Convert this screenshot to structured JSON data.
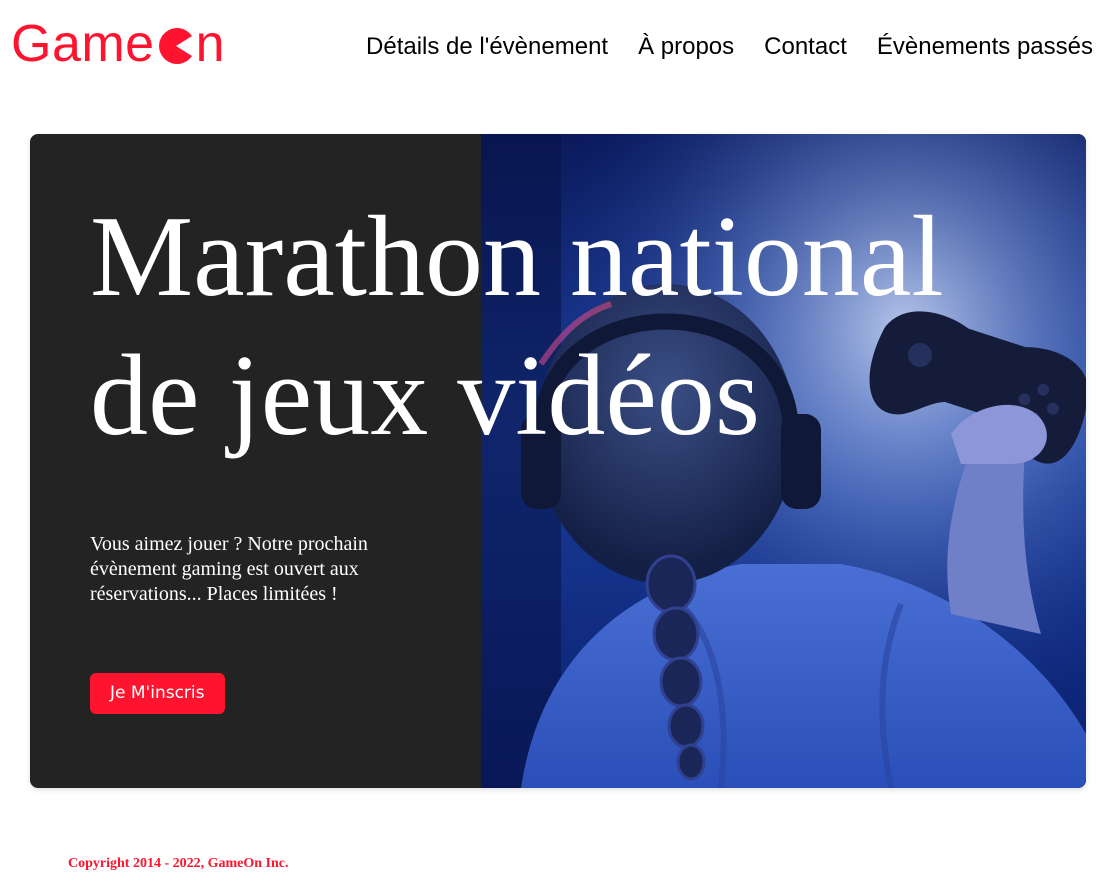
{
  "brand": {
    "name_prefix": "Game",
    "name_suffix": "n",
    "logo_icon": "pacman-o-icon",
    "accent_color": "#fe142f"
  },
  "nav": {
    "items": [
      {
        "label": "Détails de l'évènement"
      },
      {
        "label": "À propos"
      },
      {
        "label": "Contact"
      },
      {
        "label": "Évènements passés"
      }
    ]
  },
  "hero": {
    "title": "Marathon national de jeux vidéos",
    "text": "Vous aimez jouer ? Notre prochain évènement gaming est ouvert aux réservations... Places limitées !",
    "cta_label": "Je M'inscris",
    "background_color": "#232323",
    "image_subject": "gamer-with-headphones-and-controller"
  },
  "footer": {
    "copyright": "Copyright 2014 - 2022, GameOn Inc."
  }
}
